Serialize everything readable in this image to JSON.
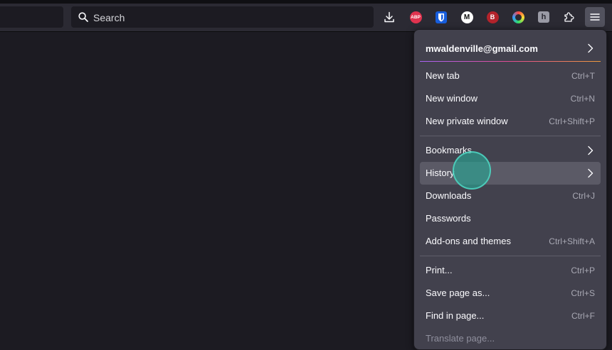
{
  "toolbar": {
    "search_placeholder": "Search",
    "extensions": [
      {
        "name": "adblock-plus",
        "label": "ABP",
        "color": "#e0334f"
      },
      {
        "name": "bitwarden",
        "color": "#175ddc"
      },
      {
        "name": "m-extension",
        "label": "M",
        "color": "#ffffff"
      },
      {
        "name": "b-extension",
        "label": "B",
        "color": "#b3232b"
      },
      {
        "name": "color-ring-extension",
        "color": "#ffffff"
      },
      {
        "name": "h-extension",
        "label": "h",
        "color": "#9a9aa5"
      }
    ]
  },
  "menu": {
    "account": "mwaldenville@gmail.com",
    "items": [
      {
        "label": "New tab",
        "shortcut": "Ctrl+T"
      },
      {
        "label": "New window",
        "shortcut": "Ctrl+N"
      },
      {
        "label": "New private window",
        "shortcut": "Ctrl+Shift+P"
      },
      {
        "label": "Bookmarks",
        "shortcut": ""
      },
      {
        "label": "History",
        "shortcut": ""
      },
      {
        "label": "Downloads",
        "shortcut": "Ctrl+J"
      },
      {
        "label": "Passwords",
        "shortcut": ""
      },
      {
        "label": "Add-ons and themes",
        "shortcut": "Ctrl+Shift+A"
      },
      {
        "label": "Print...",
        "shortcut": "Ctrl+P"
      },
      {
        "label": "Save page as...",
        "shortcut": "Ctrl+S"
      },
      {
        "label": "Find in page...",
        "shortcut": "Ctrl+F"
      },
      {
        "label": "Translate page...",
        "shortcut": ""
      }
    ]
  }
}
